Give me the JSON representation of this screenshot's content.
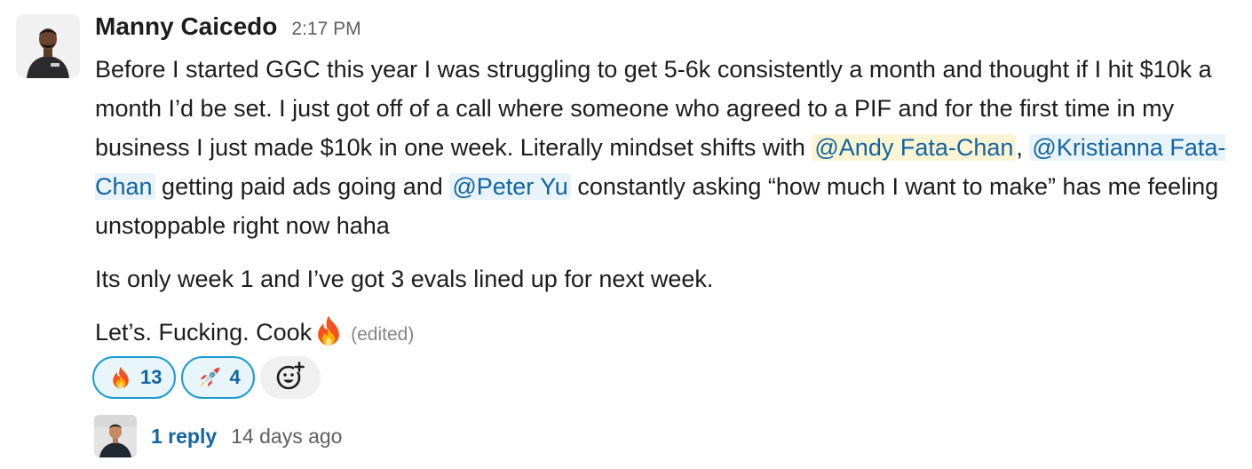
{
  "message": {
    "author": "Manny Caicedo",
    "timestamp": "2:17 PM",
    "paragraph1": {
      "text_a": "Before I started GGC this year I was struggling to get 5-6k consistently a month and thought if I hit $10k a month I’d be set. I just got off of a call where someone who agreed to a PIF and for the first time in my business I just made $10k in one week. Literally mindset shifts with ",
      "mention_1": "@Andy Fata-Chan",
      "text_b": ", ",
      "mention_2": "@Kristianna Fata-Chan",
      "text_c": " getting paid ads going and ",
      "mention_3": "@Peter Yu",
      "text_d": " constantly asking “how much I want to make” has me feeling unstoppable right now haha"
    },
    "paragraph2": "Its only week 1 and I’ve got 3 evals lined up for next week.",
    "paragraph3": "Let’s. Fucking. Cook",
    "paragraph3_emoji": "fire-emoji",
    "edited_label": "(edited)"
  },
  "reactions": [
    {
      "emoji": "fire-emoji",
      "count": "13"
    },
    {
      "emoji": "rocket-emoji",
      "count": "4"
    }
  ],
  "add_reaction_icon": "add-reaction-icon",
  "thread": {
    "reply_count": "1 reply",
    "last_reply": "14 days ago"
  },
  "colors": {
    "mention_text": "#1264a3",
    "mention_bg": "#e8f3fa",
    "self_mention_bg": "#fcf4d2",
    "reaction_border": "#1d9bd1",
    "reaction_bg": "#e8f5fa"
  }
}
